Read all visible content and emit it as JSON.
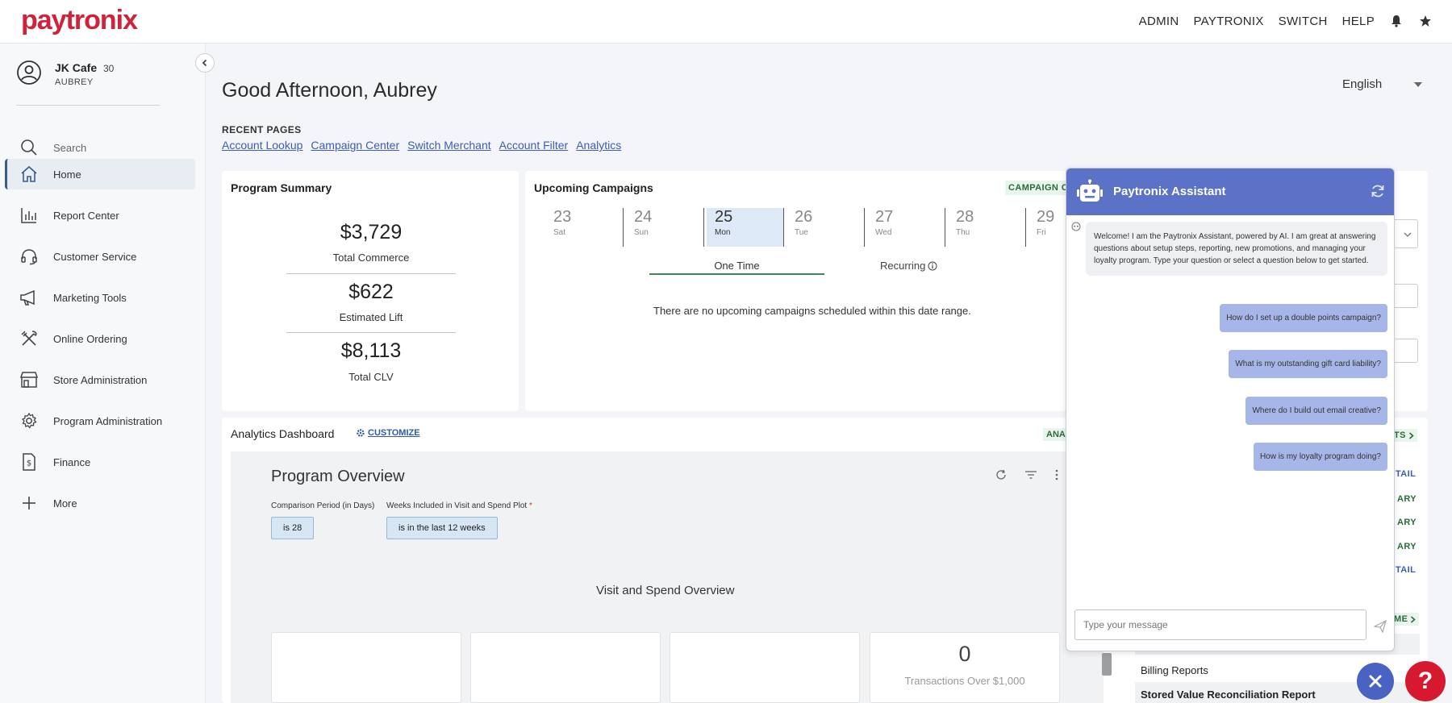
{
  "brand": {
    "logo": "paytronix",
    "accent": "#d0223b",
    "nav_blue": "#5b72c6"
  },
  "topnav": {
    "admin": "ADMIN",
    "paytronix": "PAYTRONIX",
    "switch": "SWITCH",
    "help": "HELP"
  },
  "account": {
    "name": "JK Cafe",
    "number": "30",
    "user": "AUBREY"
  },
  "sidebar": {
    "items": [
      {
        "label": "Search",
        "icon": "search-icon"
      },
      {
        "label": "Home",
        "icon": "home-icon"
      },
      {
        "label": "Report Center",
        "icon": "bar-chart-icon"
      },
      {
        "label": "Customer Service",
        "icon": "headset-icon"
      },
      {
        "label": "Marketing Tools",
        "icon": "megaphone-icon"
      },
      {
        "label": "Online Ordering",
        "icon": "utensils-icon"
      },
      {
        "label": "Store Administration",
        "icon": "store-icon"
      },
      {
        "label": "Program Administration",
        "icon": "gear-icon"
      },
      {
        "label": "Finance",
        "icon": "dollar-doc-icon"
      },
      {
        "label": "More",
        "icon": "plus-icon"
      }
    ]
  },
  "main": {
    "greeting": "Good Afternoon, Aubrey",
    "language": "English",
    "recent_title": "RECENT PAGES",
    "recent_links": [
      "Account Lookup",
      "Campaign Center",
      "Switch Merchant",
      "Account Filter",
      "Analytics"
    ]
  },
  "program_summary": {
    "title": "Program Summary",
    "stats": [
      {
        "value": "$3,729",
        "label": "Total Commerce"
      },
      {
        "value": "$622",
        "label": "Estimated Lift"
      },
      {
        "value": "$8,113",
        "label": "Total CLV"
      }
    ]
  },
  "upcoming": {
    "title": "Upcoming Campaigns",
    "badge": "CAMPAIGN C",
    "days": [
      {
        "num": "23",
        "name": "Sat"
      },
      {
        "num": "24",
        "name": "Sun"
      },
      {
        "num": "25",
        "name": "Mon"
      },
      {
        "num": "26",
        "name": "Tue"
      },
      {
        "num": "27",
        "name": "Wed"
      },
      {
        "num": "28",
        "name": "Thu"
      },
      {
        "num": "29",
        "name": "Fri"
      }
    ],
    "tab_onetime": "One Time",
    "tab_recurring": "Recurring",
    "empty": "There are no upcoming campaigns scheduled within this date range."
  },
  "analytics": {
    "title": "Analytics Dashboard",
    "customize": "CUSTOMIZE",
    "badge": "ANA",
    "overview_title": "Program Overview",
    "comparison_label": "Comparison Period (in Days)",
    "weeks_label": "Weeks Included in Visit and Spend Plot",
    "weeks_required": "*",
    "comparison_value": "is 28",
    "weeks_value": "is in the last 12 weeks",
    "visit_title": "Visit and Spend Overview",
    "tile_value": "0",
    "tile_label": "Transactions Over $1,000"
  },
  "right_column": {
    "badge_top": "TS",
    "links": [
      "TAIL",
      "ARY",
      "ARY",
      "ARY",
      "TAIL"
    ],
    "badge_bottom": "ME",
    "billing": "Billing Reports",
    "svr": "Stored Value Reconciliation Report",
    "detail": "ETAIL"
  },
  "chat": {
    "title": "Paytronix Assistant",
    "welcome": "Welcome! I am the Paytronix Assistant, powered by AI. I am great at answering questions about setup steps, reporting, new promotions, and managing your loyalty program. Type your question or select a question below to get started.",
    "suggestions": [
      "How do I set up a double points campaign?",
      "What is my outstanding gift card liability?",
      "Where do I build out email creative?",
      "How is my loyalty program doing?"
    ],
    "input_placeholder": "Type your message"
  }
}
